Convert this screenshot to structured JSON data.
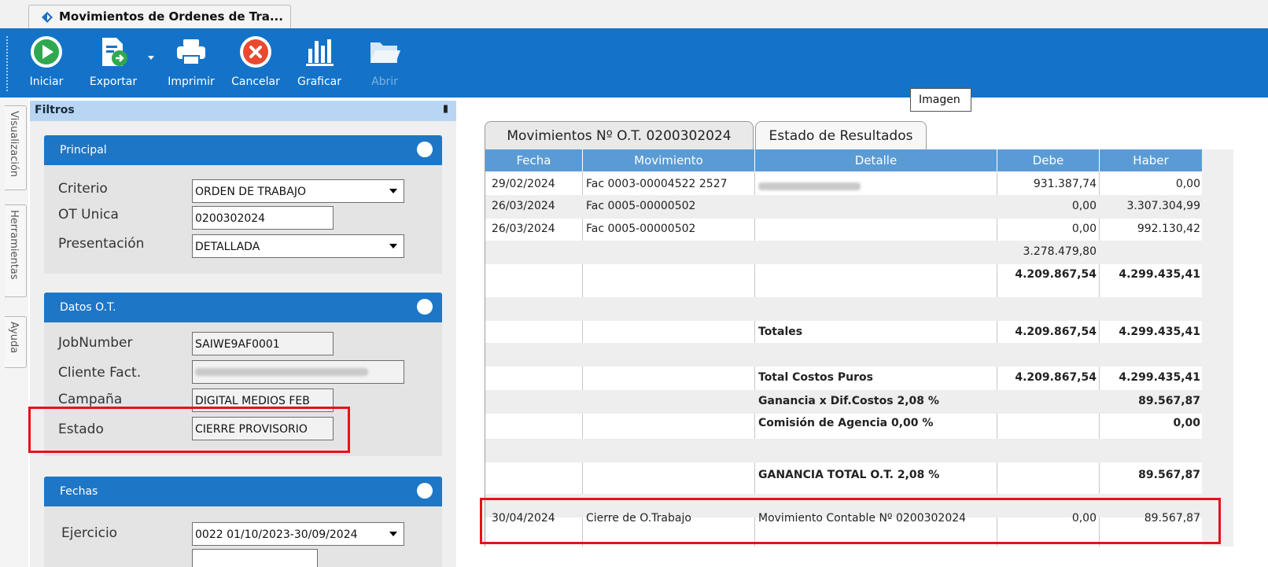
{
  "window": {
    "tab_title": "Movimientos de Ordenes de Tra..."
  },
  "toolbar": {
    "iniciar": "Iniciar",
    "exportar": "Exportar",
    "imprimir": "Imprimir",
    "cancelar": "Cancelar",
    "graficar": "Graficar",
    "abrir": "Abrir"
  },
  "colors": {
    "ribbon": "#1473c8",
    "group_header": "#1e76c7",
    "grid_header": "#5b9bd5",
    "highlight_box": "#e2141a"
  },
  "sidetabs": [
    "Visualización",
    "Herramientas",
    "Ayuda"
  ],
  "filters": {
    "title": "Filtros",
    "pin_icon": "pin-icon",
    "principal": {
      "title": "Principal",
      "criterio_label": "Criterio",
      "criterio_value": "ORDEN DE TRABAJO",
      "ot_label": "OT Unica",
      "ot_value": "0200302024",
      "presentacion_label": "Presentación",
      "presentacion_value": "DETALLADA"
    },
    "datos_ot": {
      "title": "Datos O.T.",
      "jobnumber_label": "JobNumber",
      "jobnumber_value": "SAIWE9AF0001",
      "cliente_label": "Cliente Fact.",
      "campana_label": "Campaña",
      "campana_value": "DIGITAL MEDIOS FEB",
      "estado_label": "Estado",
      "estado_value": "CIERRE PROVISORIO"
    },
    "fechas": {
      "title": "Fechas",
      "ejercicio_label": "Ejercicio",
      "ejercicio_value": "0022 01/10/2023-30/09/2024"
    }
  },
  "tooltip": "Imagen",
  "tabs": [
    "Movimientos Nº O.T. 0200302024",
    "Estado de Resultados"
  ],
  "grid": {
    "headers": [
      "Fecha",
      "Movimiento",
      "Detalle",
      "Debe",
      "Haber"
    ],
    "rows": [
      {
        "fecha": "29/02/2024",
        "movimiento": "Fac 0003-00004522 2527",
        "detalle": "",
        "debe": "931.387,74",
        "haber": "0,00"
      },
      {
        "fecha": "26/03/2024",
        "movimiento": "Fac 0005-00000502",
        "detalle": "",
        "debe": "0,00",
        "haber": "3.307.304,99"
      },
      {
        "fecha": "26/03/2024",
        "movimiento": "Fac 0005-00000502",
        "detalle": "",
        "debe": "0,00",
        "haber": "992.130,42"
      },
      {
        "fecha": "",
        "movimiento": "",
        "detalle": "",
        "debe": "3.278.479,80",
        "haber": ""
      },
      {
        "fecha": "",
        "movimiento": "",
        "detalle": "",
        "debe": "4.209.867,54",
        "haber": "4.299.435,41"
      },
      {
        "fecha": "",
        "movimiento": "",
        "detalle": "",
        "debe": "",
        "haber": ""
      },
      {
        "fecha": "",
        "movimiento": "",
        "detalle": "Totales",
        "debe": "4.209.867,54",
        "haber": "4.299.435,41"
      },
      {
        "fecha": "",
        "movimiento": "",
        "detalle": "",
        "debe": "",
        "haber": ""
      },
      {
        "fecha": "",
        "movimiento": "",
        "detalle": "Total Costos Puros",
        "debe": "4.209.867,54",
        "haber": "4.299.435,41"
      },
      {
        "fecha": "",
        "movimiento": "",
        "detalle": "Ganancia x Dif.Costos 2,08 %",
        "debe": "",
        "haber": "89.567,87"
      },
      {
        "fecha": "",
        "movimiento": "",
        "detalle": "Comisión de Agencia 0,00 %",
        "debe": "",
        "haber": "0,00"
      },
      {
        "fecha": "",
        "movimiento": "",
        "detalle": "",
        "debe": "",
        "haber": ""
      },
      {
        "fecha": "",
        "movimiento": "",
        "detalle": "GANANCIA TOTAL O.T. 2,08 %",
        "debe": "",
        "haber": "89.567,87"
      },
      {
        "fecha": "",
        "movimiento": "",
        "detalle": "",
        "debe": "",
        "haber": ""
      },
      {
        "fecha": "30/04/2024",
        "movimiento": "Cierre de O.Trabajo",
        "detalle": "Movimiento Contable Nº 0200302024",
        "debe": "0,00",
        "haber": "89.567,87"
      }
    ]
  }
}
